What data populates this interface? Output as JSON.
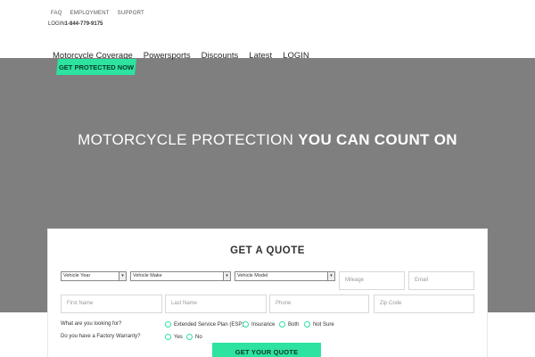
{
  "top_links": {
    "faq": "FAQ",
    "employment": "EMPLOYMENT",
    "support": "SUPPORT"
  },
  "contact": {
    "login": "LOGIN",
    "phone": "1-844-779-9175"
  },
  "nav": {
    "items": [
      "Motorcycle Coverage",
      "Powersports",
      "Discounts",
      "Latest",
      "LOGIN"
    ],
    "cta": "GET PROTECTED NOW"
  },
  "hero": {
    "headline_light": "MOTORCYCLE PROTECTION",
    "headline_bold": "YOU CAN COUNT ON"
  },
  "quote_form": {
    "title": "GET A QUOTE",
    "selects": {
      "year": "Vehicle Year",
      "make": "Vehicle Make",
      "model": "Vehicle Model"
    },
    "placeholders": {
      "mileage": "Mileage",
      "email": "Email",
      "first_name": "First Name",
      "last_name": "Last Name",
      "phone": "Phone",
      "zip": "Zip Code"
    },
    "question_looking": "What are you looking for?",
    "options_looking": [
      "Extended Service Plan (ESP)",
      "Insurance",
      "Both",
      "Not Sure"
    ],
    "question_warranty": "Do you have a Factory Warranty?",
    "options_warranty": [
      "Yes",
      "No"
    ],
    "submit": "GET YOUR QUOTE"
  },
  "colors": {
    "accent": "#2de3a0",
    "hero_bg": "#7f7f7f"
  }
}
